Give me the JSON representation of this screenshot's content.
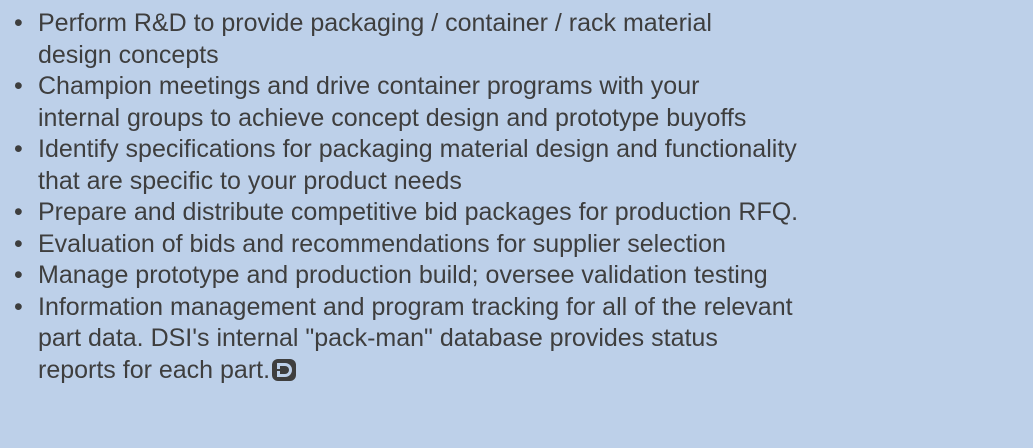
{
  "bullet_char": "•",
  "items": [
    {
      "lines": [
        "Perform R&D to provide packaging / container / rack material",
        "design concepts"
      ]
    },
    {
      "lines": [
        "Champion meetings and drive container programs with your",
        "internal groups to achieve concept design and prototype buyoffs"
      ]
    },
    {
      "lines": [
        "Identify specifications for packaging material design and functionality",
        "that are specific to your product needs"
      ]
    },
    {
      "lines": [
        "Prepare and distribute competitive bid packages for production RFQ."
      ]
    },
    {
      "lines": [
        "Evaluation of bids and recommendations for supplier selection"
      ]
    },
    {
      "lines": [
        "Manage prototype and production build; oversee validation testing"
      ]
    },
    {
      "lines": [
        "Information management and program tracking for all of the relevant",
        "part data. DSI's internal \"pack-man\" database provides status",
        "reports for each part."
      ]
    }
  ],
  "end_mark": {
    "icon": "dsi-end-mark-icon",
    "color": "#3e3e3e"
  }
}
